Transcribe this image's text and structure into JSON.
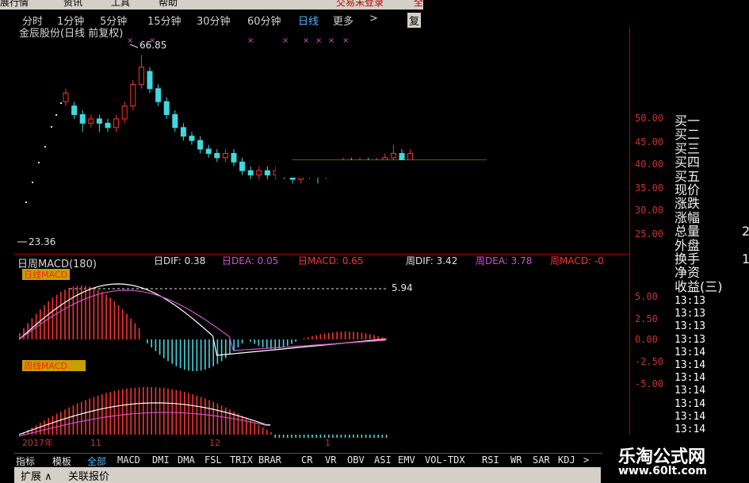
{
  "menu": {
    "items": [
      "展行情",
      "资讯",
      "工具",
      "帮助"
    ],
    "right_items": [
      "交易未登录",
      "全"
    ]
  },
  "periods": {
    "items": [
      "分时",
      "1分钟",
      "5分钟",
      "15分钟",
      "30分钟",
      "60分钟",
      "日线",
      "更多",
      ">"
    ],
    "active": "日线",
    "restore_btn": "复"
  },
  "main_chart": {
    "title": "金辰股份(日线 前复权)",
    "high_label": "66.85",
    "low_label": "23.36",
    "y_ticks": [
      "50.00",
      "45.00",
      "40.00",
      "35.00",
      "30.00",
      "25.00"
    ],
    "macd_title": "日周MACD(180)",
    "macd_values_text": [
      "日DIF: 0.38",
      "日DEA: 0.05",
      "日MACD: 0.65",
      "周DIF: 3.42",
      "周DEA: 3.78",
      "周MACD: -0"
    ]
  },
  "chart_data": {
    "type": "candlestick",
    "title": "金辰股份(日线 前复权)",
    "ylim": [
      20,
      70
    ],
    "high": 66.85,
    "low": 23.36,
    "candles": [
      {
        "o": 56,
        "c": 58,
        "h": 59,
        "l": 55
      },
      {
        "o": 55,
        "c": 53,
        "h": 56,
        "l": 52
      },
      {
        "o": 53,
        "c": 51,
        "h": 54,
        "l": 49
      },
      {
        "o": 51,
        "c": 52,
        "h": 53,
        "l": 50
      },
      {
        "o": 52,
        "c": 51,
        "h": 53,
        "l": 49
      },
      {
        "o": 51,
        "c": 50,
        "h": 52,
        "l": 49
      },
      {
        "o": 50,
        "c": 52,
        "h": 53,
        "l": 49
      },
      {
        "o": 52,
        "c": 55,
        "h": 56,
        "l": 51
      },
      {
        "o": 55,
        "c": 60,
        "h": 61,
        "l": 54
      },
      {
        "o": 60,
        "c": 64,
        "h": 66.85,
        "l": 59
      },
      {
        "o": 63,
        "c": 59,
        "h": 64,
        "l": 58
      },
      {
        "o": 59,
        "c": 56,
        "h": 60,
        "l": 55
      },
      {
        "o": 56,
        "c": 53,
        "h": 57,
        "l": 52
      },
      {
        "o": 53,
        "c": 50,
        "h": 54,
        "l": 49
      },
      {
        "o": 50,
        "c": 48,
        "h": 51,
        "l": 47
      },
      {
        "o": 48,
        "c": 47,
        "h": 49,
        "l": 46
      },
      {
        "o": 47,
        "c": 45,
        "h": 48,
        "l": 44
      },
      {
        "o": 45,
        "c": 44,
        "h": 46,
        "l": 43
      },
      {
        "o": 44,
        "c": 43,
        "h": 45,
        "l": 42
      },
      {
        "o": 43,
        "c": 44,
        "h": 45,
        "l": 42
      },
      {
        "o": 44,
        "c": 42,
        "h": 45,
        "l": 41
      },
      {
        "o": 42,
        "c": 40,
        "h": 43,
        "l": 39
      },
      {
        "o": 40,
        "c": 39,
        "h": 41,
        "l": 38
      },
      {
        "o": 39,
        "c": 40,
        "h": 41,
        "l": 38
      },
      {
        "o": 40,
        "c": 39,
        "h": 41,
        "l": 38
      },
      {
        "o": 39,
        "c": 40,
        "h": 41,
        "l": 38
      },
      {
        "o": 40,
        "c": 39,
        "h": 41,
        "l": 38
      },
      {
        "o": 39,
        "c": 38,
        "h": 40,
        "l": 37
      },
      {
        "o": 38,
        "c": 39,
        "h": 40,
        "l": 37
      },
      {
        "o": 39,
        "c": 40,
        "h": 41,
        "l": 38
      },
      {
        "o": 40,
        "c": 39,
        "h": 41,
        "l": 37
      },
      {
        "o": 39,
        "c": 41,
        "h": 42,
        "l": 38
      },
      {
        "o": 41,
        "c": 40,
        "h": 42,
        "l": 39
      },
      {
        "o": 40,
        "c": 42,
        "h": 43,
        "l": 39
      },
      {
        "o": 42,
        "c": 41,
        "h": 43,
        "l": 40
      },
      {
        "o": 41,
        "c": 42,
        "h": 43,
        "l": 40
      },
      {
        "o": 42,
        "c": 41,
        "h": 43,
        "l": 40
      },
      {
        "o": 41,
        "c": 42,
        "h": 43,
        "l": 40
      },
      {
        "o": 42,
        "c": 43,
        "h": 44,
        "l": 41
      },
      {
        "o": 43,
        "c": 44,
        "h": 46,
        "l": 42
      },
      {
        "o": 44,
        "c": 42,
        "h": 45,
        "l": 41
      },
      {
        "o": 42,
        "c": 44,
        "h": 45,
        "l": 41
      }
    ],
    "dif_label": "5.94",
    "daily_macd_label": "日线MACD",
    "weekly_macd_label": "周线MACD",
    "x_ticks": [
      "2017年",
      "11",
      "12",
      "1"
    ]
  },
  "right_axis": {
    "macd_ticks": [
      "5.00",
      "2.50",
      "0.00",
      "-2.50",
      "-5.00"
    ]
  },
  "quote_panel": {
    "labels": [
      "买一",
      "买二",
      "买三",
      "买四",
      "买五",
      "现价",
      "涨跌",
      "涨幅",
      "总量",
      "外盘",
      "换手",
      "净资",
      "收益(三)"
    ],
    "side_values": [
      "",
      "",
      "",
      "",
      "",
      "",
      "",
      "",
      "2",
      "",
      "1(",
      "",
      ""
    ],
    "times": [
      "13:13",
      "13:13",
      "13:13",
      "13:13",
      "13:14",
      "13:14",
      "13:14",
      "13:14",
      "13:14",
      "13:14",
      "13:14"
    ]
  },
  "tabs": {
    "items": [
      "指标",
      "模板",
      "全部",
      "MACD",
      "DMI",
      "DMA",
      "FSL",
      "TRIX",
      "BRAR",
      "CR",
      "VR",
      "OBV",
      "ASI",
      "EMV",
      "VOL-TDX",
      "RSI",
      "WR",
      "SAR",
      "KDJ",
      ">"
    ],
    "active": "全部"
  },
  "status": {
    "items": [
      "扩展 ∧",
      "关联报价"
    ]
  },
  "watermark": {
    "title": "乐淘公式网",
    "url": "www.60lt.com"
  },
  "colors": {
    "up": "#ff3030",
    "down": "#40d8e0",
    "dif": "#ffffff",
    "dea": "#d050d0",
    "axis": "#c83232",
    "active_tab": "#4fb6ff"
  }
}
